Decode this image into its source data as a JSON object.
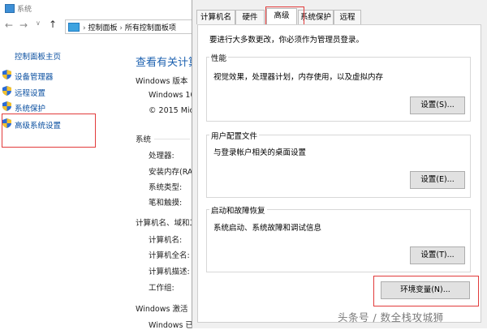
{
  "background_window": {
    "title": "系统",
    "address_path": [
      "控制面板",
      "所有控制面板项"
    ],
    "sidebar": {
      "home": "控制面板主页",
      "items": [
        {
          "label": "设备管理器"
        },
        {
          "label": "远程设置"
        },
        {
          "label": "系统保护"
        },
        {
          "label": "高级系统设置"
        }
      ]
    },
    "main": {
      "heading": "查看有关计算",
      "windows_edition_label": "Windows 版本",
      "windows_version": "Windows 10",
      "copyright": "© 2015 Mic",
      "system_label": "系统",
      "system_fields": [
        "处理器:",
        "安装内存(RA",
        "系统类型:",
        "笔和触摸:"
      ],
      "computer_label": "计算机名、域和工",
      "computer_fields": [
        "计算机名:",
        "计算机全名:",
        "计算机描述:",
        "工作组:"
      ],
      "activation_label": "Windows 激活",
      "activation_value": "Windows 已"
    }
  },
  "dialog": {
    "tabs": [
      {
        "label": "计算机名"
      },
      {
        "label": "硬件"
      },
      {
        "label": "高级",
        "active": true
      },
      {
        "label": "系统保护"
      },
      {
        "label": "远程"
      }
    ],
    "admin_note": "要进行大多数更改，你必须作为管理员登录。",
    "groups": {
      "performance": {
        "title": "性能",
        "description": "视觉效果，处理器计划，内存使用，以及虚拟内存",
        "button": "设置(S)..."
      },
      "user_profiles": {
        "title": "用户配置文件",
        "description": "与登录帐户相关的桌面设置",
        "button": "设置(E)..."
      },
      "startup_recovery": {
        "title": "启动和故障恢复",
        "description": "系统启动、系统故障和调试信息",
        "button": "设置(T)..."
      }
    },
    "env_button": "环境变量(N)..."
  },
  "watermark": "头条号 / 数全栈攻城狮",
  "colors": {
    "highlight": "#e23b3b",
    "link": "#0a4fa0",
    "heading": "#1e62b0"
  }
}
